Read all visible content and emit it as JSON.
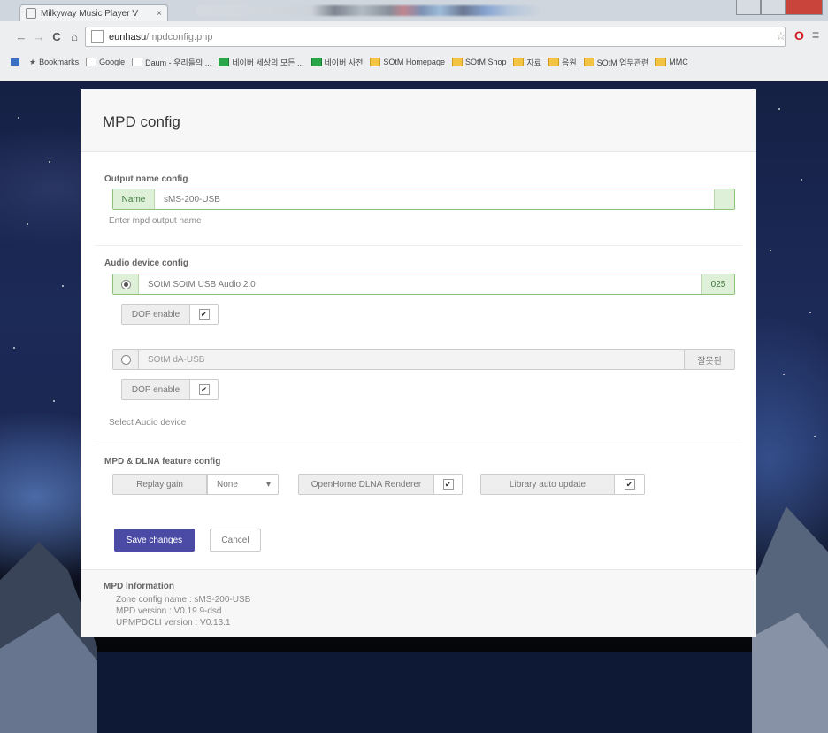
{
  "browser": {
    "tab_title": "Milkyway Music Player V",
    "tab_close": "×",
    "url_host": "eunhasu",
    "url_path": "/mpdconfig.php",
    "bookmarks": [
      {
        "label": "Bookmarks",
        "icon": "star-icon"
      },
      {
        "label": "Google",
        "icon": "page-icon"
      },
      {
        "label": "Daum - 우리들의 ...",
        "icon": "page-icon"
      },
      {
        "label": "네이버 세상의 모든 ...",
        "icon": "green-icon"
      },
      {
        "label": "네이버 사전",
        "icon": "green-icon"
      },
      {
        "label": "SOtM Homepage",
        "icon": "folder-icon"
      },
      {
        "label": "SOtM Shop",
        "icon": "folder-icon"
      },
      {
        "label": "자료",
        "icon": "folder-icon"
      },
      {
        "label": "음원",
        "icon": "folder-icon"
      },
      {
        "label": "SOtM 업무관련",
        "icon": "folder-icon"
      },
      {
        "label": "MMC",
        "icon": "folder-icon"
      }
    ]
  },
  "page": {
    "title": "MPD config",
    "output": {
      "section_label": "Output name config",
      "addon_label": "Name",
      "value": "sMS-200-USB",
      "help": "Enter mpd output name"
    },
    "audio": {
      "section_label": "Audio device config",
      "devices": [
        {
          "name": "SOtM SOtM USB Audio 2.0",
          "badge": "025",
          "dop_label": "DOP enable",
          "dop_check": "✔"
        },
        {
          "name": "SOtM dA-USB",
          "badge": "잘못된",
          "dop_label": "DOP enable",
          "dop_check": "✔"
        }
      ],
      "help": "Select Audio device"
    },
    "features": {
      "section_label": "MPD & DLNA feature config",
      "replay_gain_label": "Replay gain",
      "replay_gain_value": "None",
      "replay_gain_arrow": "▾",
      "openhome_label": "OpenHome DLNA Renderer",
      "openhome_check": "✔",
      "library_label": "Library auto update",
      "library_check": "✔"
    },
    "buttons": {
      "save": "Save changes",
      "cancel": "Cancel"
    },
    "info": {
      "title": "MPD information",
      "lines": [
        "Zone config name : sMS-200-USB",
        "MPD version : V0.19.9-dsd",
        "UPMPDCLI version : V0.13.1"
      ]
    }
  }
}
